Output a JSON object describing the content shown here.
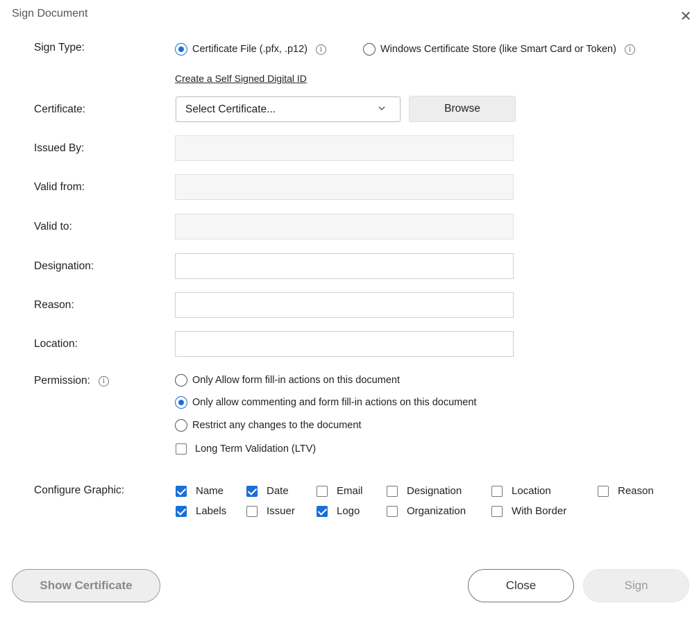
{
  "dialog": {
    "title": "Sign Document",
    "close_symbol": "✕"
  },
  "labels": {
    "sign_type": "Sign Type:",
    "certificate": "Certificate:",
    "issued_by": "Issued By:",
    "valid_from": "Valid from:",
    "valid_to": "Valid to:",
    "designation": "Designation:",
    "reason": "Reason:",
    "location": "Location:",
    "permission": "Permission:",
    "configure_graphic": "Configure Graphic:"
  },
  "sign_type": {
    "options": [
      {
        "label": "Certificate File (.pfx, .p12)",
        "selected": true
      },
      {
        "label": "Windows Certificate Store (like Smart Card or Token)",
        "selected": false
      }
    ],
    "self_signed_link": "Create a Self Signed Digital ID"
  },
  "certificate": {
    "selected_value": "Select Certificate...",
    "browse_label": "Browse"
  },
  "fields": {
    "issued_by": "",
    "valid_from": "",
    "valid_to": "",
    "designation": "",
    "reason": "",
    "location": ""
  },
  "permission": {
    "options": [
      {
        "label": "Only Allow form fill-in actions on this document",
        "selected": false
      },
      {
        "label": "Only allow commenting and form fill-in actions on this document",
        "selected": true
      },
      {
        "label": "Restrict any changes to the document",
        "selected": false
      }
    ],
    "ltv": {
      "label": "Long Term Validation (LTV)",
      "checked": false
    }
  },
  "configure_graphic": {
    "items": [
      {
        "label": "Name",
        "checked": true
      },
      {
        "label": "Date",
        "checked": true
      },
      {
        "label": "Email",
        "checked": false
      },
      {
        "label": "Designation",
        "checked": false
      },
      {
        "label": "Location",
        "checked": false
      },
      {
        "label": "Reason",
        "checked": false
      },
      {
        "label": "Labels",
        "checked": true
      },
      {
        "label": "Issuer",
        "checked": false
      },
      {
        "label": "Logo",
        "checked": true
      },
      {
        "label": "Organization",
        "checked": false
      },
      {
        "label": "With Border",
        "checked": false
      }
    ]
  },
  "buttons": {
    "show_certificate": "Show Certificate",
    "close": "Close",
    "sign": "Sign"
  },
  "colors": {
    "accent": "#1a6fd8"
  }
}
